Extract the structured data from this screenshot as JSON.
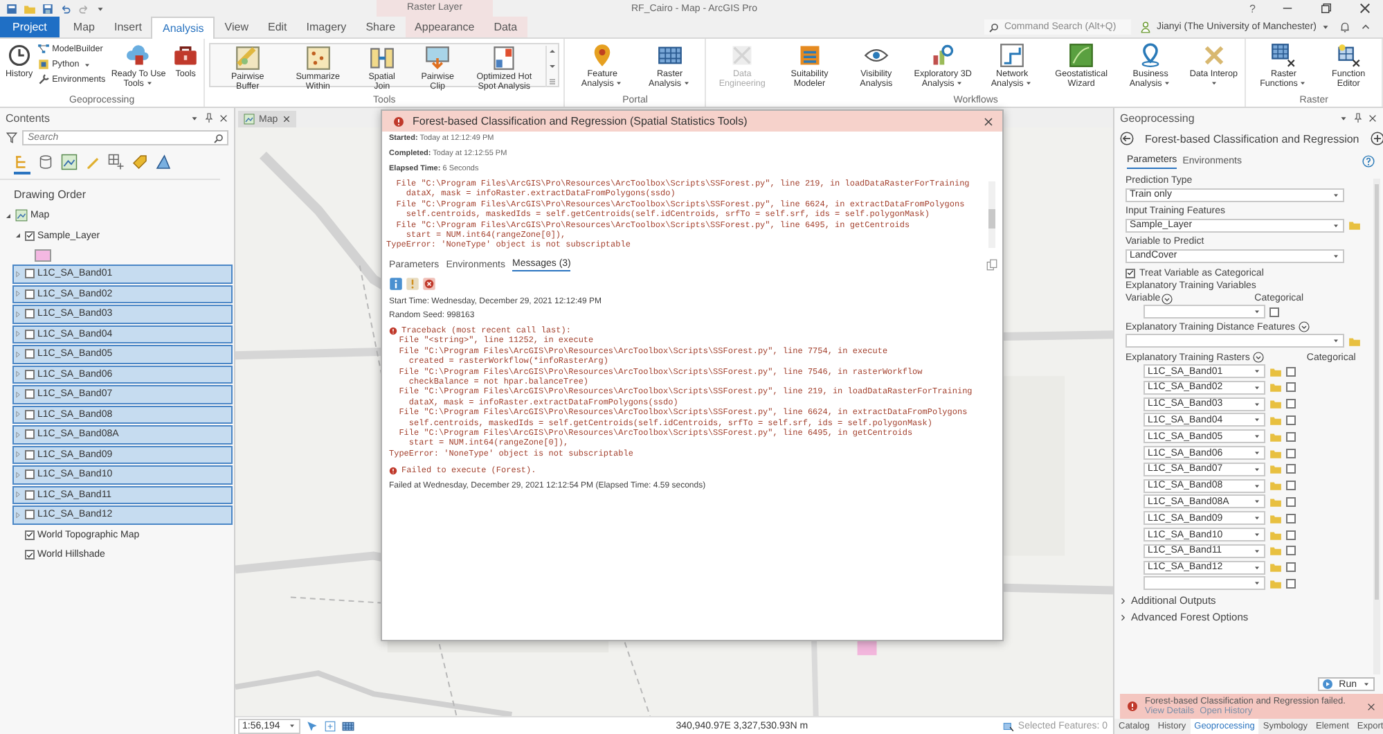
{
  "window": {
    "title": "RF_Cairo - Map - ArcGIS Pro",
    "help": "?"
  },
  "context_group": "Raster Layer",
  "tabs": [
    {
      "label": "Project",
      "kind": "project",
      "selected": false
    },
    {
      "label": "Map",
      "kind": "main",
      "selected": false
    },
    {
      "label": "Insert",
      "kind": "main",
      "selected": false
    },
    {
      "label": "Analysis",
      "kind": "main",
      "selected": true
    },
    {
      "label": "View",
      "kind": "main",
      "selected": false
    },
    {
      "label": "Edit",
      "kind": "main",
      "selected": false
    },
    {
      "label": "Imagery",
      "kind": "main",
      "selected": false
    },
    {
      "label": "Share",
      "kind": "main",
      "selected": false
    },
    {
      "label": "Appearance",
      "kind": "contextual",
      "selected": false
    },
    {
      "label": "Data",
      "kind": "contextual",
      "selected": false
    }
  ],
  "command_search": {
    "placeholder": "Command Search (Alt+Q)"
  },
  "user": "Jianyi (The University of Manchester)",
  "ribbon": [
    {
      "title": "Geoprocessing",
      "items": [
        {
          "kind": "large",
          "label": "History"
        },
        {
          "kind": "stack",
          "items": [
            {
              "label": "ModelBuilder"
            },
            {
              "label": "Python",
              "has_menu": true
            },
            {
              "label": "Environments"
            }
          ]
        },
        {
          "kind": "large",
          "label": "Ready To Use Tools",
          "has_menu": true
        },
        {
          "kind": "large",
          "label": "Tools"
        }
      ]
    },
    {
      "title": "Tools",
      "items": [
        {
          "kind": "gallery",
          "items": [
            {
              "label": "Pairwise Buffer"
            },
            {
              "label": "Summarize Within"
            },
            {
              "label": "Spatial Join"
            },
            {
              "label": "Pairwise Clip"
            },
            {
              "label": "Optimized Hot Spot Analysis"
            }
          ]
        }
      ]
    },
    {
      "title": "Portal",
      "items": [
        {
          "kind": "large",
          "label": "Feature Analysis",
          "has_menu": true
        },
        {
          "kind": "large",
          "label": "Raster Analysis",
          "has_menu": true
        }
      ]
    },
    {
      "title": "Workflows",
      "items": [
        {
          "kind": "large",
          "label": "Data Engineering",
          "disabled": true
        },
        {
          "kind": "large",
          "label": "Suitability Modeler"
        },
        {
          "kind": "large",
          "label": "Visibility Analysis"
        },
        {
          "kind": "large",
          "label": "Exploratory 3D Analysis",
          "has_menu": true
        },
        {
          "kind": "large",
          "label": "Network Analysis",
          "has_menu": true
        },
        {
          "kind": "large",
          "label": "Geostatistical Wizard"
        },
        {
          "kind": "large",
          "label": "Business Analysis",
          "has_menu": true
        },
        {
          "kind": "large",
          "label": "Data Interop",
          "has_menu": true
        }
      ]
    },
    {
      "title": "Raster",
      "items": [
        {
          "kind": "large",
          "label": "Raster Functions",
          "has_menu": true
        },
        {
          "kind": "large",
          "label": "Function Editor"
        }
      ]
    }
  ],
  "contents": {
    "title": "Contents",
    "search": {
      "placeholder": "Search"
    },
    "view_tabs": [
      {
        "selected": true
      },
      {
        "selected": false
      },
      {
        "selected": false
      },
      {
        "selected": false
      },
      {
        "selected": false
      },
      {
        "selected": false
      },
      {
        "selected": false
      }
    ],
    "heading": "Drawing Order",
    "layers": [
      {
        "kind": "map",
        "label": "Map",
        "expanded": true,
        "selected": false,
        "children": [
          {
            "kind": "layer",
            "label": "Sample_Layer",
            "checked": true,
            "expanded": true,
            "selected": false,
            "color": "#f4b8e2"
          },
          {
            "kind": "layer",
            "label": "L1C_SA_Band01",
            "checked": false,
            "expanded": false,
            "selected": true
          },
          {
            "kind": "layer",
            "label": "L1C_SA_Band02",
            "checked": false,
            "expanded": false,
            "selected": true
          },
          {
            "kind": "layer",
            "label": "L1C_SA_Band03",
            "checked": false,
            "expanded": false,
            "selected": true
          },
          {
            "kind": "layer",
            "label": "L1C_SA_Band04",
            "checked": false,
            "expanded": false,
            "selected": true
          },
          {
            "kind": "layer",
            "label": "L1C_SA_Band05",
            "checked": false,
            "expanded": false,
            "selected": true
          },
          {
            "kind": "layer",
            "label": "L1C_SA_Band06",
            "checked": false,
            "expanded": false,
            "selected": true
          },
          {
            "kind": "layer",
            "label": "L1C_SA_Band07",
            "checked": false,
            "expanded": false,
            "selected": true
          },
          {
            "kind": "layer",
            "label": "L1C_SA_Band08",
            "checked": false,
            "expanded": false,
            "selected": true
          },
          {
            "kind": "layer",
            "label": "L1C_SA_Band08A",
            "checked": false,
            "expanded": false,
            "selected": true
          },
          {
            "kind": "layer",
            "label": "L1C_SA_Band09",
            "checked": false,
            "expanded": false,
            "selected": true
          },
          {
            "kind": "layer",
            "label": "L1C_SA_Band10",
            "checked": false,
            "expanded": false,
            "selected": true
          },
          {
            "kind": "layer",
            "label": "L1C_SA_Band11",
            "checked": false,
            "expanded": false,
            "selected": true
          },
          {
            "kind": "layer",
            "label": "L1C_SA_Band12",
            "checked": false,
            "expanded": false,
            "selected": true
          },
          {
            "kind": "layer",
            "label": "World Topographic Map",
            "checked": true,
            "selected": false
          },
          {
            "kind": "layer",
            "label": "World Hillshade",
            "checked": true,
            "selected": false
          }
        ]
      }
    ]
  },
  "map_view": {
    "tab": "Map",
    "scale": "1:56,194",
    "coordinates": "340,940.97E 3,327,530.93N m",
    "selection": "Selected Features: 0"
  },
  "dialog": {
    "title": "Forest-based Classification and Regression (Spatial Statistics Tools)",
    "summary": [
      "**Started:** Today at 12:12:49 PM",
      "**Completed:** Today at 12:12:55 PM",
      "**Elapsed Time:** 6 Seconds"
    ],
    "preview_lines": [
      "  File \"C:\\Program Files\\ArcGIS\\Pro\\Resources\\ArcToolbox\\Scripts\\SSForest.py\", line 219, in loadDataRasterForTraining",
      "    dataX, mask = infoRaster.extractDataFromPolygons(ssdo)",
      "  File \"C:\\Program Files\\ArcGIS\\Pro\\Resources\\ArcToolbox\\Scripts\\SSForest.py\", line 6624, in extractDataFromPolygons",
      "    self.centroids, maskedIds = self.getCentroids(self.idCentroids, srfTo = self.srf, ids = self.polygonMask)",
      "  File \"C:\\Program Files\\ArcGIS\\Pro\\Resources\\ArcToolbox\\Scripts\\SSForest.py\", line 6495, in getCentroids",
      "    start = NUM.int64(rangeZone[0]),",
      "TypeError: 'NoneType' object is not subscriptable"
    ],
    "tabs": [
      {
        "label": "Parameters",
        "selected": false
      },
      {
        "label": "Environments",
        "selected": false
      },
      {
        "label": "Messages (3)",
        "selected": true
      }
    ],
    "filters": [
      {
        "kind": "info"
      },
      {
        "kind": "warning"
      },
      {
        "kind": "error"
      }
    ],
    "messages": [
      {
        "kind": "info",
        "text": "Start Time: Wednesday, December 29, 2021 12:12:49 PM"
      },
      {
        "kind": "info",
        "text": "Random Seed:  998163"
      },
      {
        "kind": "error",
        "lines": [
          "Traceback (most recent call last):",
          "  File \"<string>\", line 11252, in execute",
          "  File \"C:\\Program Files\\ArcGIS\\Pro\\Resources\\ArcToolbox\\Scripts\\SSForest.py\", line 7754, in execute",
          "    created = rasterWorkflow(*infoRasterArg)",
          "  File \"C:\\Program Files\\ArcGIS\\Pro\\Resources\\ArcToolbox\\Scripts\\SSForest.py\", line 7546, in rasterWorkflow",
          "    checkBalance = not hpar.balanceTree)",
          "  File \"C:\\Program Files\\ArcGIS\\Pro\\Resources\\ArcToolbox\\Scripts\\SSForest.py\", line 219, in loadDataRasterForTraining",
          "    dataX, mask = infoRaster.extractDataFromPolygons(ssdo)",
          "  File \"C:\\Program Files\\ArcGIS\\Pro\\Resources\\ArcToolbox\\Scripts\\SSForest.py\", line 6624, in extractDataFromPolygons",
          "    self.centroids, maskedIds = self.getCentroids(self.idCentroids, srfTo = self.srf, ids = self.polygonMask)",
          "  File \"C:\\Program Files\\ArcGIS\\Pro\\Resources\\ArcToolbox\\Scripts\\SSForest.py\", line 6495, in getCentroids",
          "    start = NUM.int64(rangeZone[0]),",
          "TypeError: 'NoneType' object is not subscriptable"
        ]
      },
      {
        "kind": "error",
        "lines": [
          "Failed to execute (Forest)."
        ]
      },
      {
        "kind": "info",
        "text": "Failed at Wednesday, December 29, 2021 12:12:54 PM (Elapsed Time: 4.59 seconds)"
      }
    ]
  },
  "geoprocessing": {
    "title": "Geoprocessing",
    "tool": "Forest-based Classification and Regression",
    "tabs": [
      {
        "label": "Parameters",
        "selected": true
      },
      {
        "label": "Environments",
        "selected": false
      }
    ],
    "parameters": [
      {
        "kind": "dropdown",
        "label": "Prediction Type",
        "value": "Train only"
      },
      {
        "kind": "dropdown",
        "label": "Input Training Features",
        "value": "Sample_Layer",
        "browse": true
      },
      {
        "kind": "dropdown",
        "label": "Variable to Predict",
        "value": "LandCover"
      },
      {
        "kind": "checkbox",
        "label": "Treat Variable as Categorical",
        "checked": true
      },
      {
        "kind": "variable_table",
        "label": "Explanatory Training Variables",
        "column": "Variable",
        "flag_column": "Categorical",
        "rows": [
          {
            "checked": false
          }
        ]
      },
      {
        "kind": "dropdown",
        "label": "Explanatory Training Distance Features",
        "expandable": true,
        "browse": true
      },
      {
        "kind": "raster_table",
        "label": "Explanatory Training Rasters",
        "flag_column": "Categorical",
        "rows": [
          {
            "value": "L1C_SA_Band01",
            "checked": false
          },
          {
            "value": "L1C_SA_Band02",
            "checked": false
          },
          {
            "value": "L1C_SA_Band03",
            "checked": false
          },
          {
            "value": "L1C_SA_Band04",
            "checked": false
          },
          {
            "value": "L1C_SA_Band05",
            "checked": false
          },
          {
            "value": "L1C_SA_Band06",
            "checked": false
          },
          {
            "value": "L1C_SA_Band07",
            "checked": false
          },
          {
            "value": "L1C_SA_Band08",
            "checked": false
          },
          {
            "value": "L1C_SA_Band08A",
            "checked": false
          },
          {
            "value": "L1C_SA_Band09",
            "checked": false
          },
          {
            "value": "L1C_SA_Band10",
            "checked": false
          },
          {
            "value": "L1C_SA_Band11",
            "checked": false
          },
          {
            "value": "L1C_SA_Band12",
            "checked": false
          },
          {
            "checked": false
          }
        ]
      }
    ],
    "sections": [
      {
        "label": "Additional Outputs",
        "expanded": false
      },
      {
        "label": "Advanced Forest Options",
        "expanded": false
      }
    ],
    "run": "Run",
    "banner": {
      "message": "Forest-based Classification and Regression failed.",
      "links": [
        "View Details",
        "Open History"
      ]
    },
    "pane_tabs": [
      {
        "label": "Catalog",
        "selected": false
      },
      {
        "label": "History",
        "selected": false
      },
      {
        "label": "Geoprocessing",
        "selected": true
      },
      {
        "label": "Symbology",
        "selected": false
      },
      {
        "label": "Element",
        "selected": false
      },
      {
        "label": "Export",
        "selected": false
      }
    ]
  }
}
